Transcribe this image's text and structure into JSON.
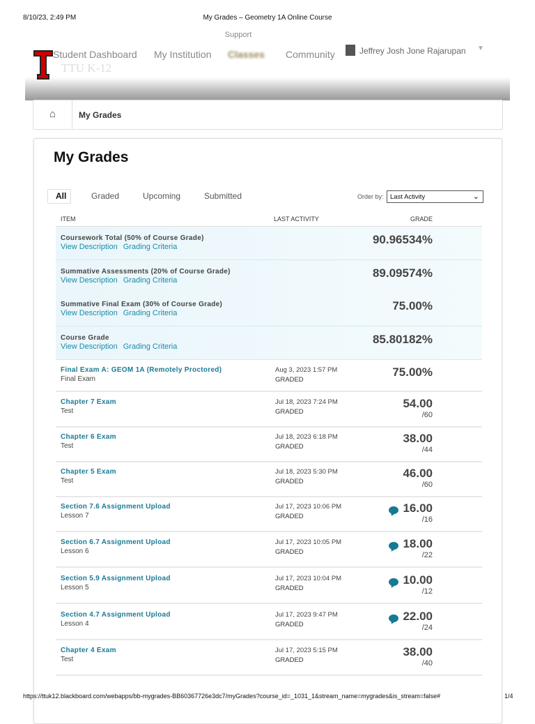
{
  "print": {
    "datetime": "8/10/23, 2:49 PM",
    "title": "My Grades – Geometry 1A Online Course",
    "url": "https://ttuk12.blackboard.com/webapps/bb-mygrades-BB60367726e3dc7/myGrades?course_id=_1031_1&stream_name=mygrades&is_stream=false#",
    "page": "1/4"
  },
  "header": {
    "support": "Support",
    "nav": [
      "Student Dashboard",
      "My Institution",
      "Classes",
      "Community"
    ],
    "user": "Jeffrey Josh Jone Rajarupan",
    "brand": "TTU K-12"
  },
  "breadcrumb": {
    "current": "My Grades"
  },
  "page": {
    "title": "My Grades",
    "tabs": [
      "All",
      "Graded",
      "Upcoming",
      "Submitted"
    ],
    "order_label": "Order by:",
    "order_value": "Last Activity"
  },
  "table": {
    "headers": [
      "ITEM",
      "LAST ACTIVITY",
      "GRADE"
    ],
    "summary": [
      {
        "title": "Coursework Total (50% of Course Grade)",
        "grade": "90.96534%"
      },
      {
        "title": "Summative Assessments (20% of Course Grade)",
        "grade": "89.09574%"
      },
      {
        "title": "Summative Final Exam (30% of Course Grade)",
        "grade": "75.00%"
      },
      {
        "title": "Course Grade",
        "grade": "85.80182%"
      }
    ],
    "link_view": "View Description",
    "link_criteria": "Grading Criteria",
    "items": [
      {
        "title": "Final Exam A: GEOM 1A (Remotely Proctored)",
        "type": "Final Exam",
        "date": "Aug 3, 2023 1:57 PM",
        "status": "GRADED",
        "grade": "75.00%",
        "outof": "",
        "comment": false
      },
      {
        "title": "Chapter 7 Exam",
        "type": "Test",
        "date": "Jul 18, 2023 7:24 PM",
        "status": "GRADED",
        "grade": "54.00",
        "outof": "/60",
        "comment": false
      },
      {
        "title": "Chapter 6 Exam",
        "type": "Test",
        "date": "Jul 18, 2023 6:18 PM",
        "status": "GRADED",
        "grade": "38.00",
        "outof": "/44",
        "comment": false
      },
      {
        "title": "Chapter 5 Exam",
        "type": "Test",
        "date": "Jul 18, 2023 5:30 PM",
        "status": "GRADED",
        "grade": "46.00",
        "outof": "/60",
        "comment": false
      },
      {
        "title": "Section 7.6 Assignment Upload",
        "type": "Lesson 7",
        "date": "Jul 17, 2023 10:06 PM",
        "status": "GRADED",
        "grade": "16.00",
        "outof": "/16",
        "comment": true
      },
      {
        "title": "Section 6.7 Assignment Upload",
        "type": "Lesson 6",
        "date": "Jul 17, 2023 10:05 PM",
        "status": "GRADED",
        "grade": "18.00",
        "outof": "/22",
        "comment": true
      },
      {
        "title": "Section 5.9 Assignment Upload",
        "type": "Lesson 5",
        "date": "Jul 17, 2023 10:04 PM",
        "status": "GRADED",
        "grade": "10.00",
        "outof": "/12",
        "comment": true
      },
      {
        "title": "Section 4.7 Assignment Upload",
        "type": "Lesson 4",
        "date": "Jul 17, 2023 9:47 PM",
        "status": "GRADED",
        "grade": "22.00",
        "outof": "/24",
        "comment": true
      },
      {
        "title": "Chapter 4 Exam",
        "type": "Test",
        "date": "Jul 17, 2023 5:15 PM",
        "status": "GRADED",
        "grade": "38.00",
        "outof": "/40",
        "comment": false
      }
    ]
  }
}
